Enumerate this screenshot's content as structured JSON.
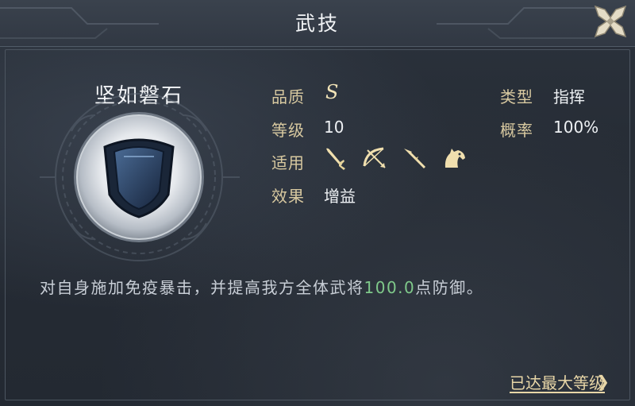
{
  "window": {
    "title": "武技"
  },
  "skill": {
    "name": "坚如磐石",
    "icon": "shield-icon"
  },
  "info": {
    "quality_label": "品质",
    "quality_value": "S",
    "level_label": "等级",
    "level_value": "10",
    "applicable_label": "适用",
    "applicable_icons": [
      "sword-icon",
      "bow-icon",
      "spear-icon",
      "horse-icon"
    ],
    "effect_label": "效果",
    "effect_value": "增益",
    "type_label": "类型",
    "type_value": "指挥",
    "chance_label": "概率",
    "chance_value": "100%"
  },
  "description": {
    "before": "对自身施加免疫暴击，并提高我方全体武将",
    "highlight": "100.0",
    "after": "点防御。"
  },
  "footer": {
    "max_level_label": "已达最大等级",
    "arrow": "❯"
  },
  "colors": {
    "label_gold": "#d8c9a0",
    "highlight_green": "#7fc98a",
    "icon_gold": "#f0dfae"
  }
}
